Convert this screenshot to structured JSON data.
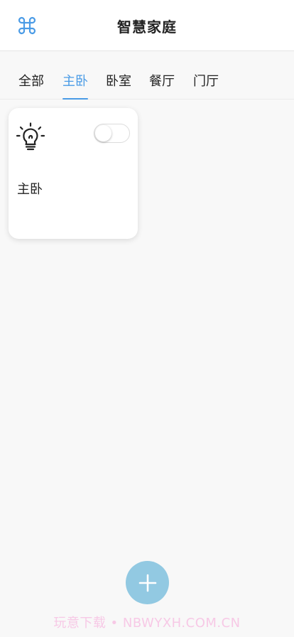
{
  "header": {
    "title": "智慧家庭",
    "menu_icon": "command-icon",
    "accent": "#4a9be6"
  },
  "tabs": [
    {
      "label": "全部",
      "active": false
    },
    {
      "label": "主卧",
      "active": true
    },
    {
      "label": "卧室",
      "active": false
    },
    {
      "label": "餐厅",
      "active": false
    },
    {
      "label": "门厅",
      "active": false
    }
  ],
  "devices": [
    {
      "label": "主卧",
      "icon": "lightbulb-icon",
      "on": false
    }
  ],
  "fab": {
    "icon": "plus-icon",
    "color": "#92c9e2"
  },
  "watermark": "玩意下载 • NBWYXH.COM.CN"
}
